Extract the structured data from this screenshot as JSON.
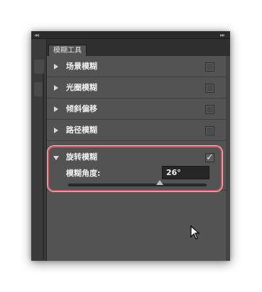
{
  "panel": {
    "collapse_left": "◂◂",
    "collapse_right": "▸▸",
    "tab_title": "模糊工具",
    "rows": [
      {
        "label": "场景模糊",
        "checked": false
      },
      {
        "label": "光圈模糊",
        "checked": false
      },
      {
        "label": "倾斜偏移",
        "checked": false
      },
      {
        "label": "路径模糊",
        "checked": false
      }
    ],
    "expanded": {
      "label": "旋转模糊",
      "checked": true,
      "check_glyph": "✓",
      "field_label": "模糊角度:",
      "field_value": "26°",
      "slider_fraction": 0.66
    }
  },
  "colors": {
    "panel_bg": "#535353",
    "highlight": "#d45a6a",
    "input_bg": "#262626"
  },
  "icons": {
    "row_arrow": "triangle-right-icon",
    "expanded_arrow": "triangle-down-icon",
    "cursor": "mouse-pointer-icon"
  }
}
